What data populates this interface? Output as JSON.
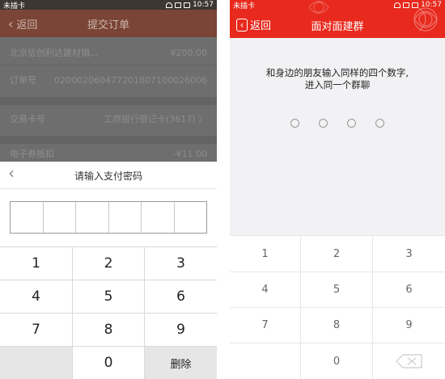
{
  "left_phone": {
    "status_bar": {
      "carrier": "未插卡",
      "time": "10:57"
    },
    "header": {
      "back_label": "返回",
      "title": "提交订单"
    },
    "order_rows": [
      {
        "label": "北京信创利达建材销...",
        "value": "¥200.00"
      },
      {
        "label": "订单号",
        "value": "020002060477201807100026006"
      },
      {
        "label": "交易卡号",
        "value": "工商银行借记卡(3617) 〉"
      },
      {
        "label": "电子券抵扣",
        "value": "-¥11.00"
      }
    ],
    "password_panel": {
      "title": "请输入支付密码",
      "keys": [
        "1",
        "2",
        "3",
        "4",
        "5",
        "6",
        "7",
        "8",
        "9",
        "",
        "0",
        "删除"
      ]
    }
  },
  "right_phone": {
    "status_bar": {
      "carrier": "未插卡",
      "time": "10:57"
    },
    "header": {
      "back_label": "返回",
      "title": "面对面建群"
    },
    "hint_line1": "和身边的朋友输入同样的四个数字,",
    "hint_line2": "进入同一个群聊",
    "digit_slots": 4,
    "keys": [
      "1",
      "2",
      "3",
      "4",
      "5",
      "6",
      "7",
      "8",
      "9",
      "",
      "0",
      "backspace-icon"
    ]
  },
  "colors": {
    "accent_red": "#e8291d",
    "dim_overlay": "#6e6e6e",
    "keypad_gray": "#e6e6e6"
  }
}
